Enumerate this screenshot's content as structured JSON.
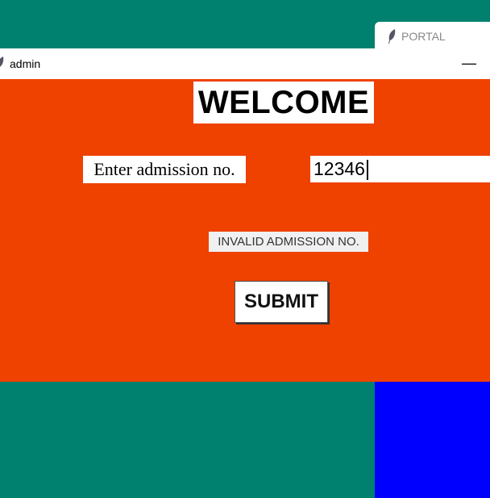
{
  "portal_window": {
    "title": "PORTAL",
    "icon": "feather-icon"
  },
  "admin_window": {
    "title": "admin",
    "icon": "feather-icon",
    "minimize_glyph": "—"
  },
  "form": {
    "heading": "WELCOME",
    "admission_label": "Enter admission no.",
    "admission_value": "12346",
    "status_message": "INVALID ADMISSION NO.",
    "submit_label": "SUBMIT"
  },
  "colors": {
    "desktop": "#00806f",
    "admin_body": "#ef4100",
    "blue_panel": "#0000ff"
  }
}
